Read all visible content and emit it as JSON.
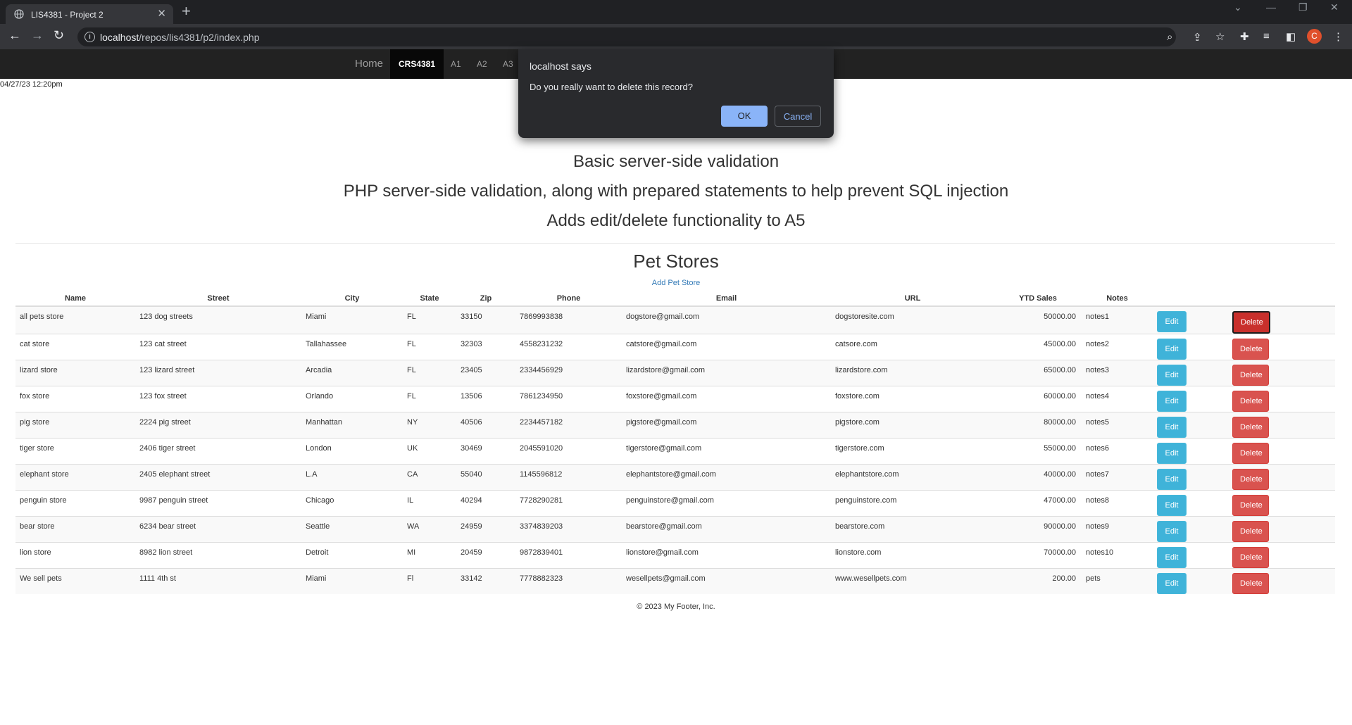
{
  "browser": {
    "tab_title": "LIS4381 - Project 2",
    "new_tab": "+",
    "url_host": "localhost",
    "url_path": "/repos/lis4381/p2/index.php",
    "profile_initial": "C"
  },
  "nav": {
    "home": "Home",
    "active": "CRS4381",
    "items": [
      "A1",
      "A2",
      "A3"
    ]
  },
  "datestamp": "04/27/23 12:20pm",
  "leads": [
    "Basic server-side validation",
    "PHP server-side validation, along with prepared statements to help prevent SQL injection",
    "Adds edit/delete functionality to A5"
  ],
  "section_title": "Pet Stores",
  "add_link": "Add Pet Store",
  "table": {
    "headers": [
      "Name",
      "Street",
      "City",
      "State",
      "Zip",
      "Phone",
      "Email",
      "URL",
      "YTD Sales",
      "Notes",
      "",
      ""
    ],
    "edit_label": "Edit",
    "delete_label": "Delete",
    "rows": [
      [
        "all pets store",
        "123 dog streets",
        "Miami",
        "FL",
        "33150",
        "7869993838",
        "dogstore@gmail.com",
        "dogstoresite.com",
        "50000.00",
        "notes1"
      ],
      [
        "cat store",
        "123 cat street",
        "Tallahassee",
        "FL",
        "32303",
        "4558231232",
        "catstore@gmail.com",
        "catsore.com",
        "45000.00",
        "notes2"
      ],
      [
        "lizard store",
        "123 lizard street",
        "Arcadia",
        "FL",
        "23405",
        "2334456929",
        "lizardstore@gmail.com",
        "lizardstore.com",
        "65000.00",
        "notes3"
      ],
      [
        "fox store",
        "123 fox street",
        "Orlando",
        "FL",
        "13506",
        "7861234950",
        "foxstore@gmail.com",
        "foxstore.com",
        "60000.00",
        "notes4"
      ],
      [
        "pig store",
        "2224 pig street",
        "Manhattan",
        "NY",
        "40506",
        "2234457182",
        "pigstore@gmail.com",
        "pigstore.com",
        "80000.00",
        "notes5"
      ],
      [
        "tiger store",
        "2406 tiger street",
        "London",
        "UK",
        "30469",
        "2045591020",
        "tigerstore@gmail.com",
        "tigerstore.com",
        "55000.00",
        "notes6"
      ],
      [
        "elephant store",
        "2405 elephant street",
        "L.A",
        "CA",
        "55040",
        "1145596812",
        "elephantstore@gmail.com",
        "elephantstore.com",
        "40000.00",
        "notes7"
      ],
      [
        "penguin store",
        "9987 penguin street",
        "Chicago",
        "IL",
        "40294",
        "7728290281",
        "penguinstore@gmail.com",
        "penguinstore.com",
        "47000.00",
        "notes8"
      ],
      [
        "bear store",
        "6234 bear street",
        "Seattle",
        "WA",
        "24959",
        "3374839203",
        "bearstore@gmail.com",
        "bearstore.com",
        "90000.00",
        "notes9"
      ],
      [
        "lion store",
        "8982 lion street",
        "Detroit",
        "MI",
        "20459",
        "9872839401",
        "lionstore@gmail.com",
        "lionstore.com",
        "70000.00",
        "notes10"
      ],
      [
        "We sell pets",
        "1111 4th st",
        "Miami",
        "Fl",
        "33142",
        "7778882323",
        "wesellpets@gmail.com",
        "www.wesellpets.com",
        "200.00",
        "pets"
      ]
    ]
  },
  "footer": "© 2023 My Footer, Inc.",
  "dialog": {
    "title": "localhost says",
    "message": "Do you really want to delete this record?",
    "ok": "OK",
    "cancel": "Cancel"
  },
  "colors": {
    "edit": "#3fb3d9",
    "delete": "#d9534f",
    "dialog_ok": "#8ab4f8",
    "navbar": "#222222"
  }
}
